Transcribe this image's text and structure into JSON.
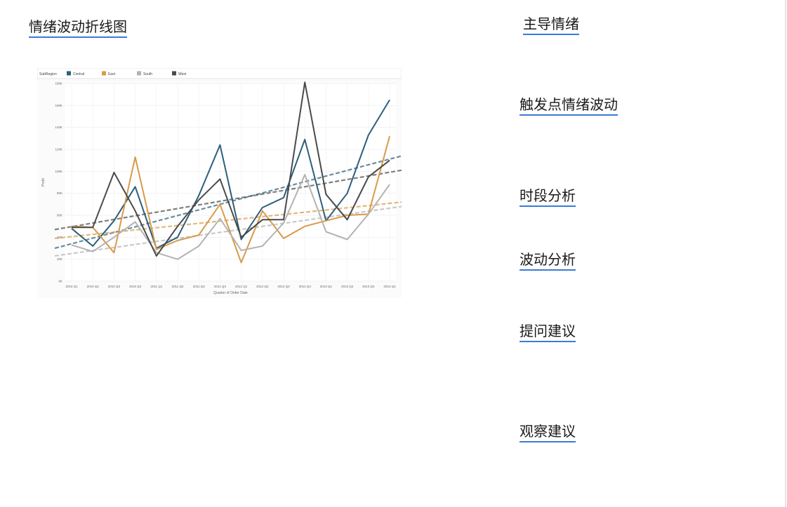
{
  "headings": {
    "chart_title": "情绪波动折线图",
    "dominant": "主导情绪",
    "triggers": "触发点情绪波动",
    "time_analysis": "时段分析",
    "fluctuation": "波动分析",
    "questions": "提问建议",
    "observation": "观察建议"
  },
  "chart_data": {
    "type": "line",
    "legend_title": "SubRegion",
    "xlabel": "Quarter of Order Date",
    "ylabel": "Profit",
    "ylim": [
      0,
      180
    ],
    "yticks": [
      "0K",
      "20K",
      "40K",
      "60K",
      "80K",
      "100K",
      "120K",
      "140K",
      "160K",
      "180K"
    ],
    "categories": [
      "2010 Q1",
      "2010 Q2",
      "2010 Q3",
      "2010 Q4",
      "2011 Q1",
      "2011 Q2",
      "2011 Q3",
      "2011 Q4",
      "2012 Q1",
      "2012 Q2",
      "2012 Q3",
      "2012 Q4",
      "2013 Q1",
      "2013 Q2",
      "2013 Q3",
      "2013 Q4"
    ],
    "grid": true,
    "legend_position": "top",
    "series": [
      {
        "name": "Central",
        "color": "#2c5f7c",
        "values": [
          48,
          32,
          55,
          86,
          30,
          40,
          78,
          124,
          38,
          67,
          76,
          129,
          55,
          80,
          133,
          165
        ],
        "trend": [
          30,
          114
        ]
      },
      {
        "name": "East",
        "color": "#d99a48",
        "values": [
          50,
          49,
          26,
          113,
          29,
          37,
          42,
          70,
          17,
          64,
          39,
          50,
          55,
          60,
          61,
          132
        ],
        "trend": [
          39,
          72
        ]
      },
      {
        "name": "South",
        "color": "#b3b3b3",
        "values": [
          33,
          27,
          40,
          54,
          26,
          20,
          32,
          57,
          28,
          32,
          53,
          97,
          45,
          38,
          61,
          88
        ],
        "trend": [
          23,
          68
        ]
      },
      {
        "name": "West",
        "color": "#4a4a4a",
        "values": [
          49,
          49,
          99,
          64,
          23,
          50,
          74,
          93,
          40,
          56,
          56,
          181,
          79,
          56,
          95,
          110
        ],
        "trend": [
          47,
          101
        ]
      }
    ]
  }
}
